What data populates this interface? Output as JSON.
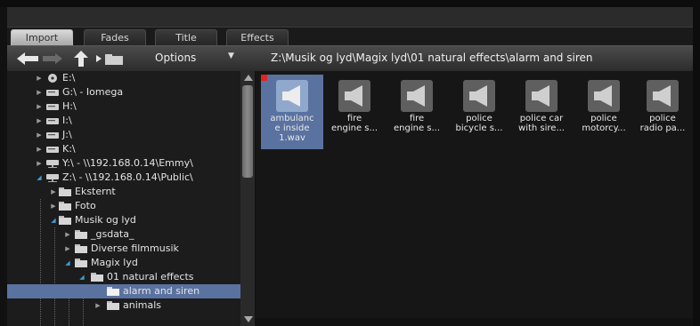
{
  "tabs": [
    {
      "label": "Import",
      "active": true
    },
    {
      "label": "Fades",
      "active": false
    },
    {
      "label": "Title",
      "active": false
    },
    {
      "label": "Effects",
      "active": false
    }
  ],
  "toolbar": {
    "back_icon": "arrow-left-icon",
    "forward_icon": "arrow-right-icon",
    "up_icon": "arrow-up-icon",
    "folder_nav_icon": "folder-nav-icon",
    "options_label": "Options",
    "path": "Z:\\Musik og lyd\\Magix lyd\\01 natural effects\\alarm and siren"
  },
  "tree": {
    "items": [
      {
        "label": "E:\\",
        "icon": "cd-drive-icon"
      },
      {
        "label": "G:\\ - Iomega",
        "icon": "drive-icon"
      },
      {
        "label": "H:\\",
        "icon": "drive-icon"
      },
      {
        "label": "I:\\",
        "icon": "drive-icon"
      },
      {
        "label": "J:\\",
        "icon": "drive-icon"
      },
      {
        "label": "K:\\",
        "icon": "drive-icon"
      },
      {
        "label": "Y:\\ - \\\\192.168.0.14\\Emmy\\",
        "icon": "network-drive-icon"
      },
      {
        "label": "Z:\\ - \\\\192.168.0.14\\Public\\",
        "icon": "network-drive-icon"
      },
      {
        "label": "Eksternt",
        "icon": "folder-icon"
      },
      {
        "label": "Foto",
        "icon": "folder-icon"
      },
      {
        "label": "Musik og lyd",
        "icon": "folder-icon"
      },
      {
        "label": "_gsdata_",
        "icon": "folder-icon"
      },
      {
        "label": "Diverse filmmusik",
        "icon": "folder-icon"
      },
      {
        "label": "Magix lyd",
        "icon": "folder-icon"
      },
      {
        "label": "01 natural effects",
        "icon": "folder-icon"
      },
      {
        "label": "alarm and siren",
        "icon": "folder-icon"
      },
      {
        "label": "animals",
        "icon": "folder-icon"
      }
    ]
  },
  "files": [
    {
      "label": "ambulanc\ne inside\n1.wav",
      "icon": "speaker-icon",
      "selected": true
    },
    {
      "label": "fire\nengine s...",
      "icon": "speaker-icon",
      "selected": false
    },
    {
      "label": "fire\nengine s...",
      "icon": "speaker-icon",
      "selected": false
    },
    {
      "label": "police\nbicycle s...",
      "icon": "speaker-icon",
      "selected": false
    },
    {
      "label": "police car\nwith sire...",
      "icon": "speaker-icon",
      "selected": false
    },
    {
      "label": "police\nmotorcy...",
      "icon": "speaker-icon",
      "selected": false
    },
    {
      "label": "police\nradio pa...",
      "icon": "speaker-icon",
      "selected": false
    }
  ],
  "colors": {
    "selection": "#5a72a0",
    "accent_expander": "#3aa0d8",
    "marker": "#e02424"
  }
}
